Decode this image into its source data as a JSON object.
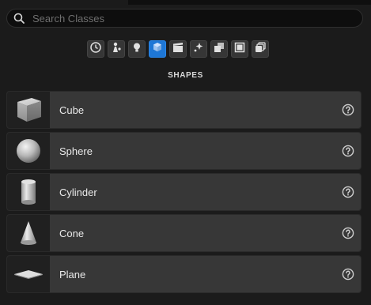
{
  "search": {
    "placeholder": "Search Classes",
    "icon": "search-icon"
  },
  "categories": [
    {
      "icon": "clock-icon",
      "active": false
    },
    {
      "icon": "actor-icon",
      "active": false
    },
    {
      "icon": "lightbulb-icon",
      "active": false
    },
    {
      "icon": "cube-icon",
      "active": true
    },
    {
      "icon": "clapperboard-icon",
      "active": false
    },
    {
      "icon": "sparkle-icon",
      "active": false
    },
    {
      "icon": "volumes-icon",
      "active": false
    },
    {
      "icon": "panel-icon",
      "active": false
    },
    {
      "icon": "all-classes-icon",
      "active": false
    }
  ],
  "section": {
    "title": "SHAPES"
  },
  "shapes": [
    {
      "label": "Cube",
      "icon": "cube-thumbnail-icon"
    },
    {
      "label": "Sphere",
      "icon": "sphere-thumbnail-icon"
    },
    {
      "label": "Cylinder",
      "icon": "cylinder-thumbnail-icon"
    },
    {
      "label": "Cone",
      "icon": "cone-thumbnail-icon"
    },
    {
      "label": "Plane",
      "icon": "plane-thumbnail-icon"
    }
  ],
  "colors": {
    "accent": "#1e77d6",
    "row": "#373737",
    "background": "#1b1b1b"
  }
}
